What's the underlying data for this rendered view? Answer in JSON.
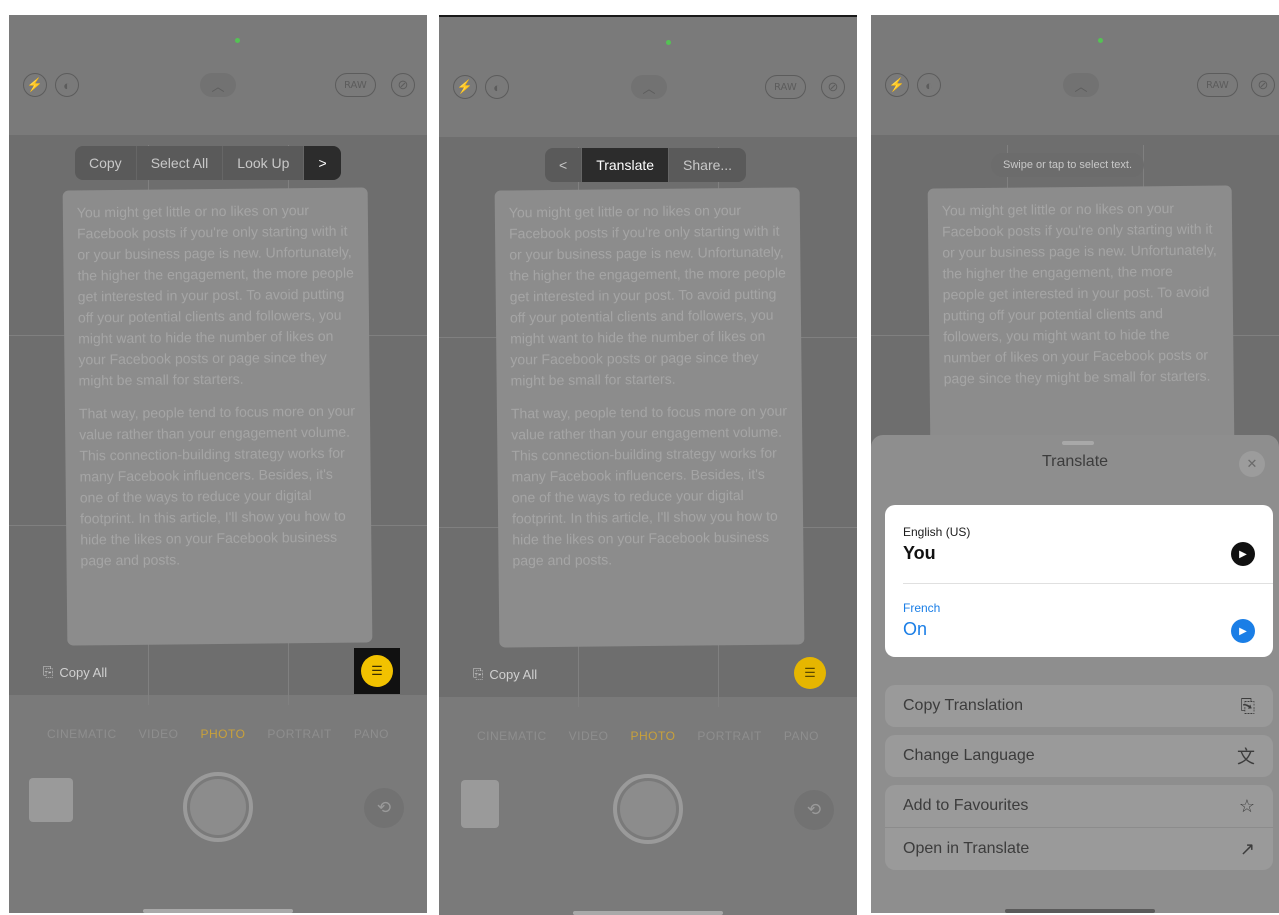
{
  "camera": {
    "raw_label": "RAW",
    "modes": [
      "CINEMATIC",
      "VIDEO",
      "PHOTO",
      "PORTRAIT",
      "PANO"
    ],
    "active_mode": "PHOTO",
    "copy_all": "Copy All"
  },
  "document_text": {
    "paragraph1": "You might get little or no likes on your Facebook posts if you're only starting with it or your business page is new. Unfortunately, the higher the engagement, the more people get interested in your post. To avoid putting off your potential clients and followers, you might want to hide the number of likes on your Facebook posts or page since they might be small for starters.",
    "paragraph2": "That way, people tend to focus more on your value rather than your engagement volume. This connection-building strategy works for many Facebook influencers. Besides, it's one of the ways to reduce your digital footprint. In this article, I'll show you how to hide the likes on your Facebook business page and posts."
  },
  "panel1": {
    "menu": {
      "copy": "Copy",
      "select_all": "Select All",
      "look_up": "Look Up",
      "more": ">"
    }
  },
  "panel2": {
    "menu": {
      "back": "<",
      "translate": "Translate",
      "share": "Share..."
    }
  },
  "panel3": {
    "hint": "Swipe or tap to select text.",
    "sheet": {
      "title": "Translate",
      "close": "✕",
      "source_language": "English (US)",
      "source_text": "You",
      "target_language": "French",
      "target_text": "On",
      "actions": {
        "copy_translation": "Copy Translation",
        "change_language": "Change Language",
        "add_to_favourites": "Add to Favourites",
        "open_in_translate": "Open in Translate"
      }
    },
    "colors": {
      "accent_blue": "#1a7ee6",
      "live_text_yellow": "#f2c200"
    }
  }
}
